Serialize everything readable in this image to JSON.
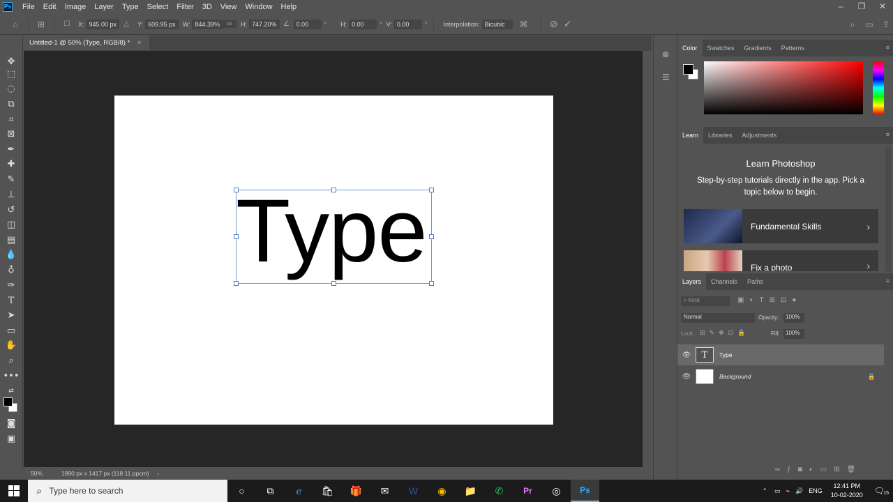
{
  "app": {
    "logo": "Ps",
    "menu": [
      "File",
      "Edit",
      "Image",
      "Layer",
      "Type",
      "Select",
      "Filter",
      "3D",
      "View",
      "Window",
      "Help"
    ]
  },
  "options": {
    "x_label": "X:",
    "x_value": "945.00 px",
    "y_label": "Y:",
    "y_value": "609.95 px",
    "w_label": "W:",
    "w_value": "844.39%",
    "h_label": "H:",
    "h_value": "747.20%",
    "angle_value": "0.00",
    "angle_unit": "°",
    "hskew_label": "H:",
    "hskew_value": "0.00",
    "vskew_label": "V:",
    "vskew_value": "0.00",
    "interp_label": "Interpolation:",
    "interp_value": "Bicubic"
  },
  "document": {
    "tab_title": "Untitled-1 @ 50% (Type, RGB/8) *",
    "tab_close": "×",
    "canvas_text": "Type",
    "zoom": "50%",
    "doc_info": "1890 px x 1417 px (118.11 ppcm)"
  },
  "color_panel": {
    "tabs": [
      "Color",
      "Swatches",
      "Gradients",
      "Patterns"
    ]
  },
  "learn_panel": {
    "tabs": [
      "Learn",
      "Libraries",
      "Adjustments"
    ],
    "title": "Learn Photoshop",
    "description": "Step-by-step tutorials directly in the app. Pick a topic below to begin.",
    "cards": [
      "Fundamental Skills",
      "Fix a photo"
    ]
  },
  "layers_panel": {
    "tabs": [
      "Layers",
      "Channels",
      "Paths"
    ],
    "filter_placeholder": "Kind",
    "blend_mode": "Normal",
    "opacity_label": "Opacity:",
    "opacity_value": "100%",
    "lock_label": "Lock:",
    "fill_label": "Fill:",
    "fill_value": "100%",
    "layers": [
      {
        "name": "Type",
        "thumb": "T"
      },
      {
        "name": "Background"
      }
    ]
  },
  "taskbar": {
    "search_placeholder": "Type here to search",
    "language": "ENG",
    "time": "12:41 PM",
    "date": "10-02-2020",
    "notification_count": "15"
  },
  "colors": {
    "ui_bg": "#535353",
    "canvas_bg": "#262626",
    "accent_blue": "#31a8ff",
    "selection_blue": "#6f9ad6"
  }
}
